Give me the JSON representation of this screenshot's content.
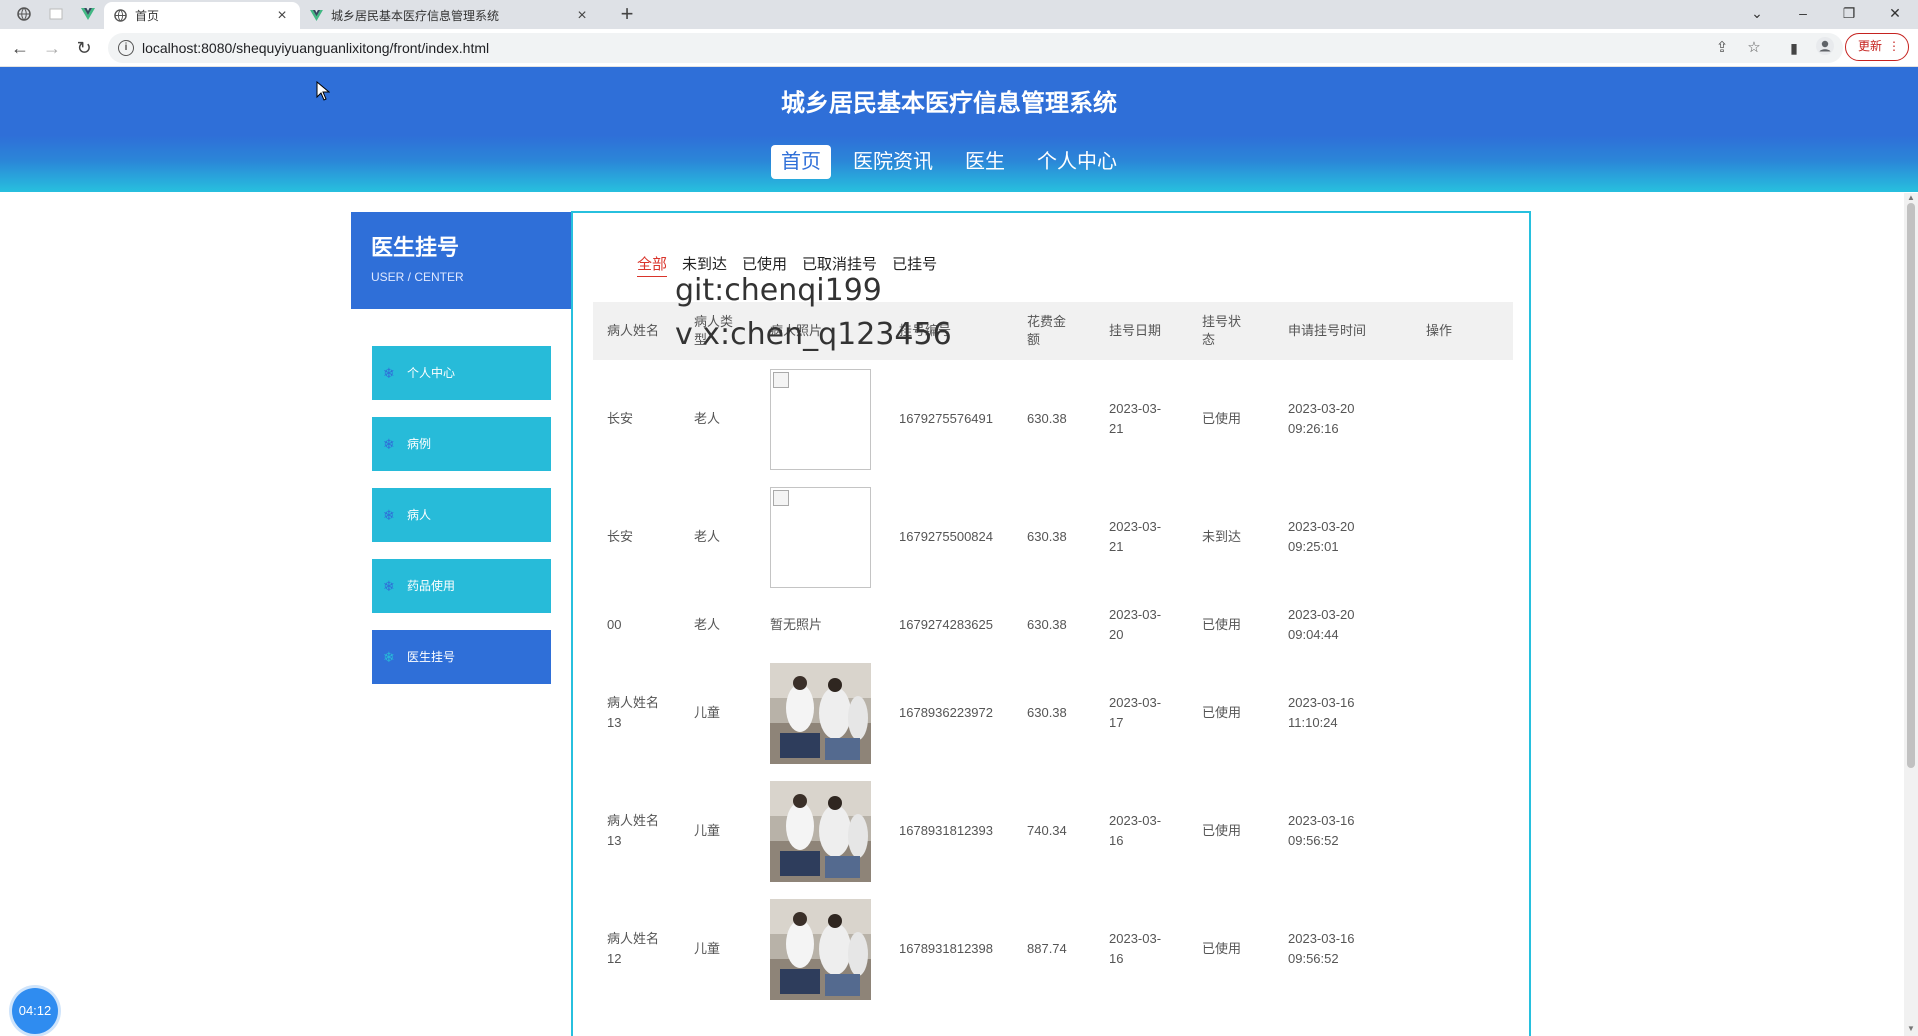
{
  "browser": {
    "tabs": [
      {
        "title": "首页",
        "active": true
      },
      {
        "title": "城乡居民基本医疗信息管理系统",
        "active": false
      }
    ],
    "url": "localhost:8080/shequyiyuanguanlixitong/front/index.html",
    "update_label": "更新",
    "new_tab_symbol": "+",
    "close_symbol": "×"
  },
  "site": {
    "title": "城乡居民基本医疗信息管理系统",
    "nav": [
      {
        "label": "首页",
        "active": true
      },
      {
        "label": "医院资讯",
        "active": false
      },
      {
        "label": "医生",
        "active": false
      },
      {
        "label": "个人中心",
        "active": false
      }
    ]
  },
  "sidebar": {
    "title": "医生挂号",
    "subtitle": "USER / CENTER",
    "items": [
      {
        "label": "个人中心",
        "active": false
      },
      {
        "label": "病例",
        "active": false
      },
      {
        "label": "病人",
        "active": false
      },
      {
        "label": "药品使用",
        "active": false
      },
      {
        "label": "医生挂号",
        "active": true
      }
    ]
  },
  "filters": [
    {
      "label": "全部",
      "active": true
    },
    {
      "label": "未到达",
      "active": false
    },
    {
      "label": "已使用",
      "active": false
    },
    {
      "label": "已取消挂号",
      "active": false
    },
    {
      "label": "已挂号",
      "active": false
    }
  ],
  "table": {
    "headers": [
      "病人姓名",
      "病人类型",
      "病人照片",
      "挂号编号",
      "花费金额",
      "挂号日期",
      "挂号状态",
      "申请挂号时间",
      "操作"
    ],
    "rows": [
      {
        "name": "长安",
        "type": "老人",
        "photo": "broken",
        "photo_text": "",
        "number": "1679275576491",
        "amount": "630.38",
        "date": "2023-03-21",
        "status": "已使用",
        "apply_time": "2023-03-20 09:26:16"
      },
      {
        "name": "长安",
        "type": "老人",
        "photo": "broken",
        "photo_text": "",
        "number": "1679275500824",
        "amount": "630.38",
        "date": "2023-03-21",
        "status": "未到达",
        "apply_time": "2023-03-20 09:25:01"
      },
      {
        "name": "00",
        "type": "老人",
        "photo": "none",
        "photo_text": "暂无照片",
        "number": "1679274283625",
        "amount": "630.38",
        "date": "2023-03-20",
        "status": "已使用",
        "apply_time": "2023-03-20 09:04:44"
      },
      {
        "name": "病人姓名13",
        "type": "儿童",
        "photo": "image",
        "photo_text": "",
        "number": "1678936223972",
        "amount": "630.38",
        "date": "2023-03-17",
        "status": "已使用",
        "apply_time": "2023-03-16 11:10:24"
      },
      {
        "name": "病人姓名13",
        "type": "儿童",
        "photo": "image",
        "photo_text": "",
        "number": "1678931812393",
        "amount": "740.34",
        "date": "2023-03-16",
        "status": "已使用",
        "apply_time": "2023-03-16 09:56:52"
      },
      {
        "name": "病人姓名12",
        "type": "儿童",
        "photo": "image",
        "photo_text": "",
        "number": "1678931812398",
        "amount": "887.74",
        "date": "2023-03-16",
        "status": "已使用",
        "apply_time": "2023-03-16 09:56:52"
      }
    ]
  },
  "watermark": {
    "line1": "git:chenqi199",
    "line2": "v x:chen_q123456"
  },
  "timer": "04:12",
  "colors": {
    "primary_blue": "#2f6fd8",
    "cyan": "#27bbd9",
    "active_filter_red": "#d9342b"
  }
}
